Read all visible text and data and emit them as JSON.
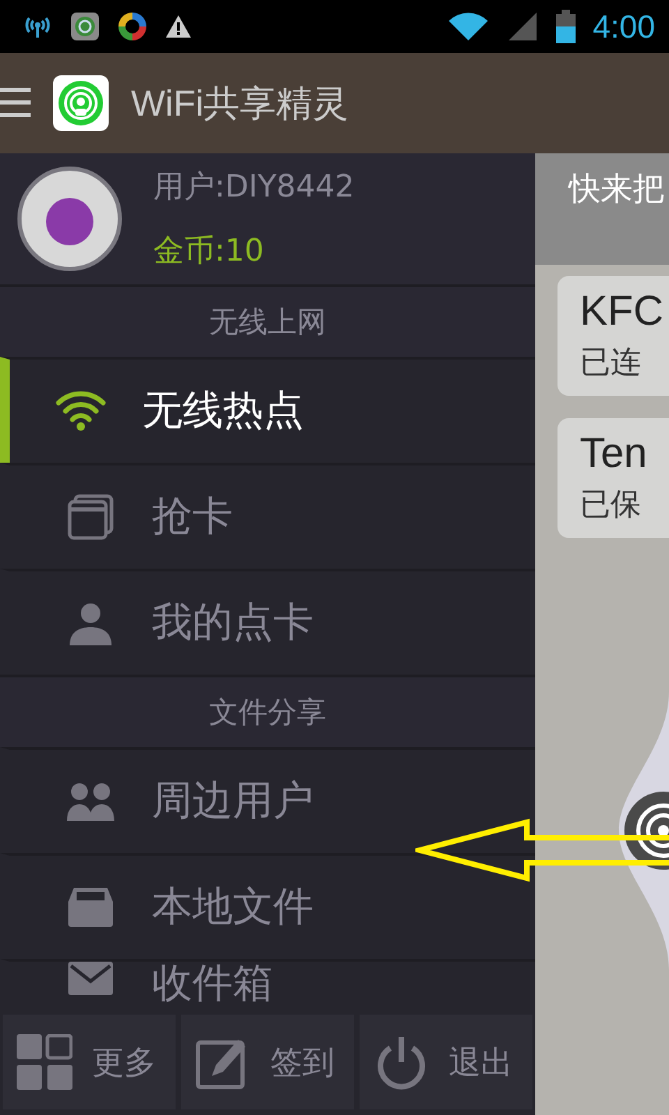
{
  "status_bar": {
    "time": "4:00"
  },
  "app_bar": {
    "title": "WiFi共享精灵"
  },
  "profile": {
    "user": "用户:DIY8442",
    "coins": "金币:10"
  },
  "menu": [
    {
      "kind": "header",
      "label": "无线上网"
    },
    {
      "kind": "item",
      "label": "无线热点",
      "selected": true
    },
    {
      "kind": "item",
      "label": "抢卡",
      "selected": false
    },
    {
      "kind": "item",
      "label": "我的点卡",
      "selected": false
    },
    {
      "kind": "header",
      "label": "文件分享"
    },
    {
      "kind": "item",
      "label": "周边用户",
      "selected": false
    },
    {
      "kind": "item",
      "label": "本地文件",
      "selected": false
    },
    {
      "kind": "item",
      "label": "收件箱",
      "selected": false
    }
  ],
  "bottom_buttons": [
    {
      "label": "更多"
    },
    {
      "label": "签到"
    },
    {
      "label": "退出"
    }
  ],
  "content": {
    "banner": "快来把",
    "networks": [
      {
        "name": "KFC",
        "status": "已连"
      },
      {
        "name": "Ten",
        "status": "已保"
      }
    ]
  }
}
